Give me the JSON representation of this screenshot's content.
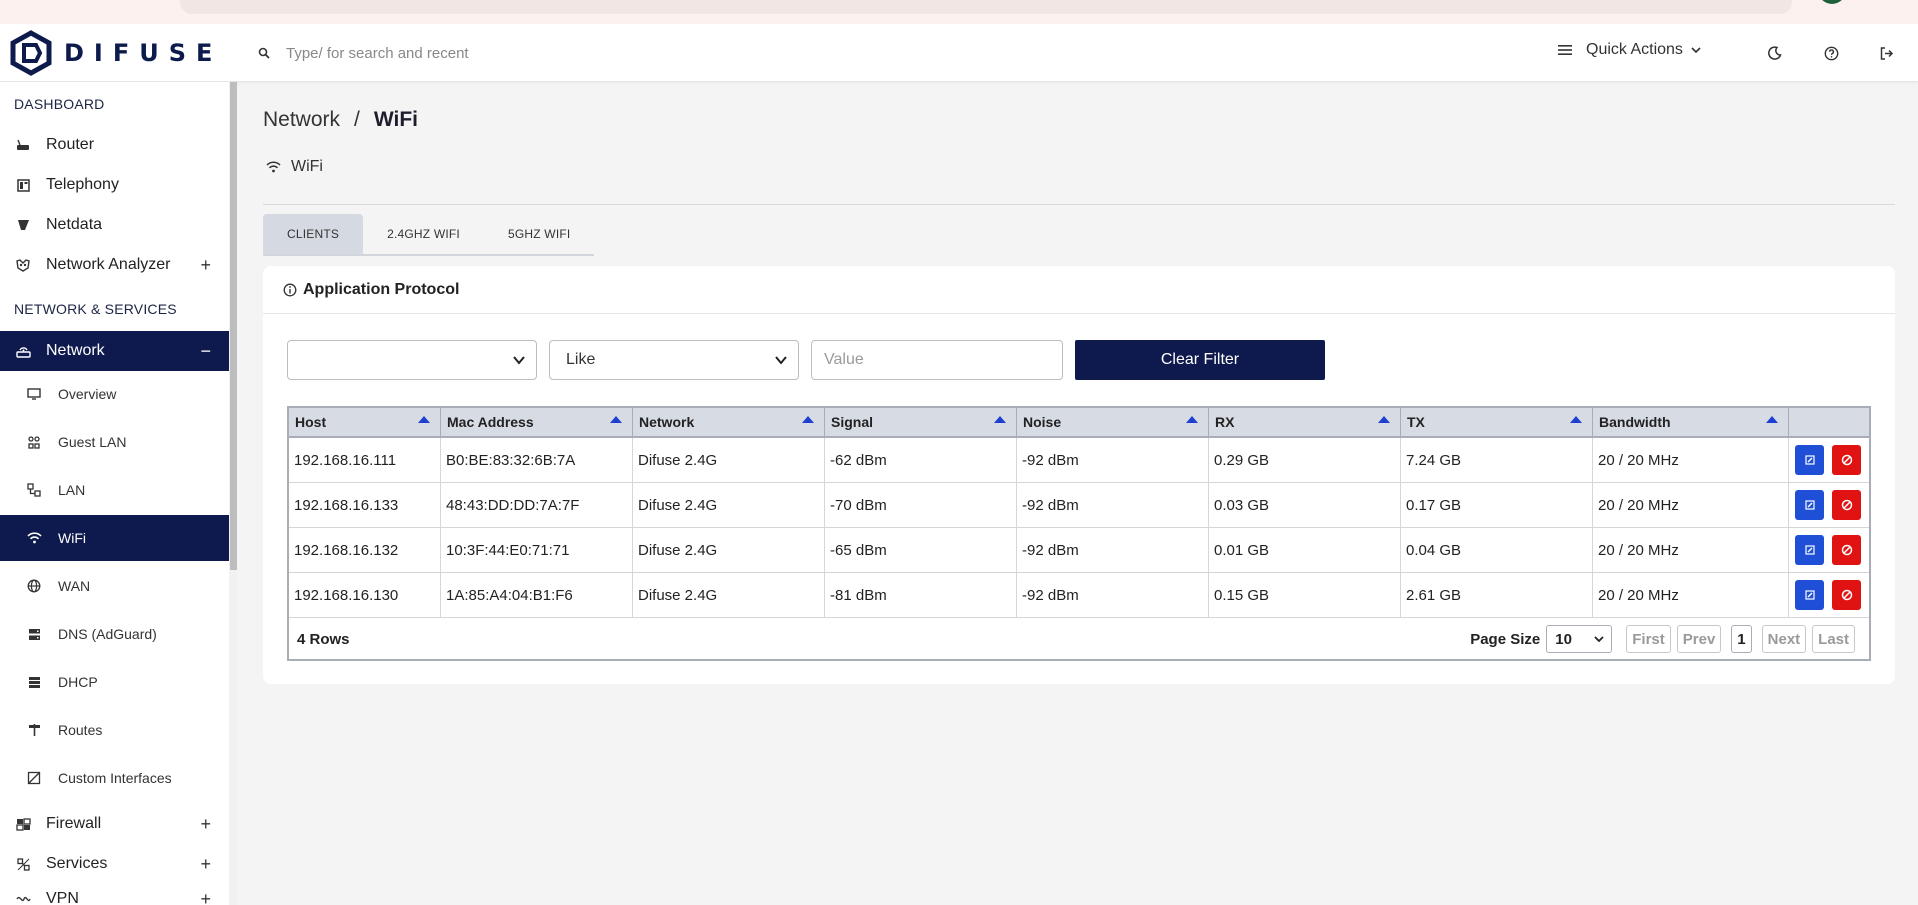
{
  "brand": {
    "name": "DIFUSE"
  },
  "search": {
    "placeholder": "Type/ for search and recent"
  },
  "header": {
    "quick_actions_label": "Quick Actions"
  },
  "sidebar": {
    "sections": [
      "DASHBOARD",
      "NETWORK & SERVICES"
    ],
    "dashboard_items": [
      {
        "label": "Router",
        "icon": "router-icon"
      },
      {
        "label": "Telephony",
        "icon": "telephony-icon"
      },
      {
        "label": "Netdata",
        "icon": "netdata-icon"
      },
      {
        "label": "Network Analyzer",
        "icon": "analyzer-icon",
        "expandable": true
      }
    ],
    "network_group": {
      "label": "Network",
      "expanded": true
    },
    "network_children": [
      {
        "label": "Overview",
        "icon": "monitor-icon"
      },
      {
        "label": "Guest LAN",
        "icon": "guest-lan-icon"
      },
      {
        "label": "LAN",
        "icon": "lan-icon"
      },
      {
        "label": "WiFi",
        "icon": "wifi-icon",
        "active": true
      },
      {
        "label": "WAN",
        "icon": "globe-icon"
      },
      {
        "label": "DNS (AdGuard)",
        "icon": "server-icon"
      },
      {
        "label": "DHCP",
        "icon": "dhcp-icon"
      },
      {
        "label": "Routes",
        "icon": "signpost-icon"
      },
      {
        "label": "Custom Interfaces",
        "icon": "custom-interface-icon"
      }
    ],
    "bottom_items": [
      {
        "label": "Firewall",
        "icon": "firewall-icon",
        "expandable": true
      },
      {
        "label": "Services",
        "icon": "services-icon",
        "expandable": true
      },
      {
        "label": "VPN",
        "icon": "vpn-icon",
        "expandable": true
      }
    ]
  },
  "breadcrumb": {
    "parent": "Network",
    "separator": "/",
    "current": "WiFi"
  },
  "page_subtitle": "WiFi",
  "tabs": [
    {
      "label": "CLIENTS",
      "active": true
    },
    {
      "label": "2.4GHZ WIFI"
    },
    {
      "label": "5GHZ WIFI"
    }
  ],
  "card": {
    "title": "Application Protocol"
  },
  "filter": {
    "field_value": "",
    "operator_value": "Like",
    "value_placeholder": "Value",
    "clear_label": "Clear Filter"
  },
  "table": {
    "columns": [
      "Host",
      "Mac Address",
      "Network",
      "Signal",
      "Noise",
      "RX",
      "TX",
      "Bandwidth"
    ],
    "rows": [
      [
        "192.168.16.111",
        "B0:BE:83:32:6B:7A",
        "Difuse 2.4G",
        "-62 dBm",
        "-92 dBm",
        "0.29 GB",
        "7.24 GB",
        "20 / 20 MHz"
      ],
      [
        "192.168.16.133",
        "48:43:DD:DD:7A:7F",
        "Difuse 2.4G",
        "-70 dBm",
        "-92 dBm",
        "0.03 GB",
        "0.17 GB",
        "20 / 20 MHz"
      ],
      [
        "192.168.16.132",
        "10:3F:44:E0:71:71",
        "Difuse 2.4G",
        "-65 dBm",
        "-92 dBm",
        "0.01 GB",
        "0.04 GB",
        "20 / 20 MHz"
      ],
      [
        "192.168.16.130",
        "1A:85:A4:04:B1:F6",
        "Difuse 2.4G",
        "-81 dBm",
        "-92 dBm",
        "0.15 GB",
        "2.61 GB",
        "20 / 20 MHz"
      ]
    ],
    "row_count_label": "4 Rows",
    "page_size_label": "Page Size",
    "page_size_value": "10",
    "pager": {
      "first": "First",
      "prev": "Prev",
      "current": "1",
      "next": "Next",
      "last": "Last"
    }
  },
  "colors": {
    "brand_navy": "#0e1a4e",
    "edit_button": "#1f4fd6",
    "delete_button": "#e11212",
    "sort_arrow": "#1f3fd1"
  }
}
